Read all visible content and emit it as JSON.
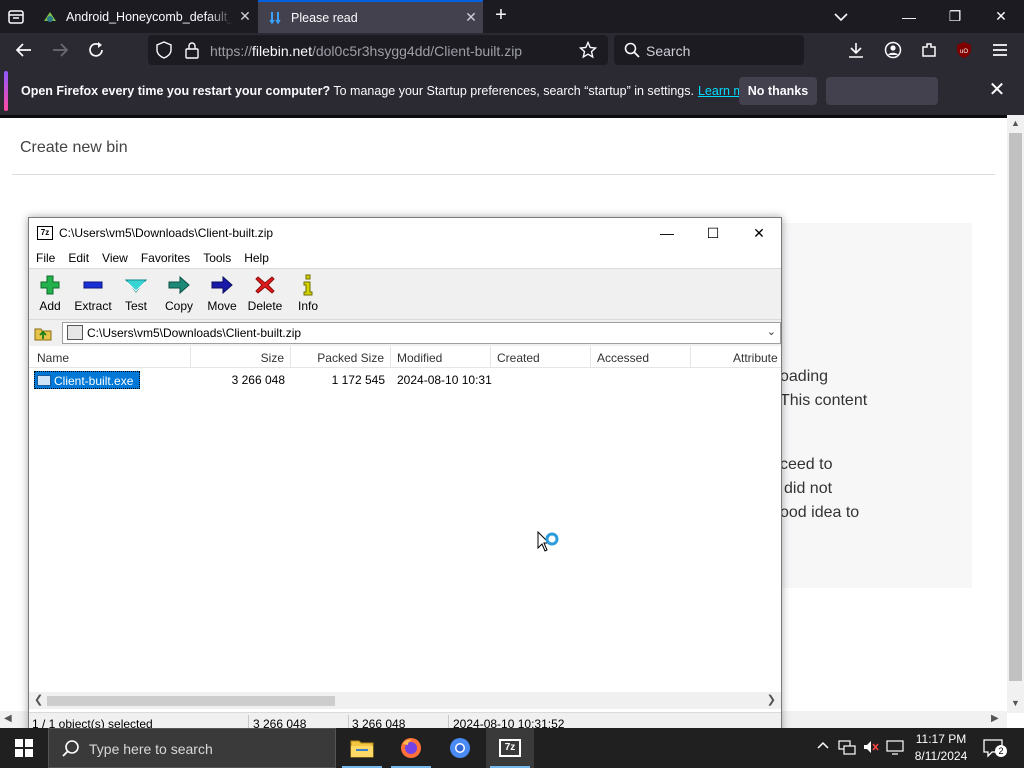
{
  "browser": {
    "tabs": [
      {
        "label": "Android_Honeycomb_default_w",
        "favicon": "android-honeycomb-icon"
      },
      {
        "label": "Please read",
        "favicon": "filebin-icon"
      }
    ],
    "address": {
      "prefix": "https://",
      "host": "filebin.net",
      "path": "/dol0c5r3hsygg4dd/Client-built.zip"
    },
    "search_placeholder": "Search",
    "notification": {
      "bold": "Open Firefox every time you restart your computer?",
      "text": "To manage your Startup preferences, search “startup” in settings.",
      "link": "Learn more",
      "no_thanks": "No thanks"
    }
  },
  "page": {
    "create_bin": "Create new bin",
    "fragments": [
      "oading",
      "This content",
      "ceed to",
      "did not",
      "ood idea to"
    ]
  },
  "zip": {
    "title": "C:\\Users\\vm5\\Downloads\\Client-built.zip",
    "menu": [
      "File",
      "Edit",
      "View",
      "Favorites",
      "Tools",
      "Help"
    ],
    "toolbar": [
      "Add",
      "Extract",
      "Test",
      "Copy",
      "Move",
      "Delete",
      "Info"
    ],
    "path": "C:\\Users\\vm5\\Downloads\\Client-built.zip",
    "columns": [
      "Name",
      "Size",
      "Packed Size",
      "Modified",
      "Created",
      "Accessed",
      "Attribute"
    ],
    "files": [
      {
        "name": "Client-built.exe",
        "size": "3 266 048",
        "packed": "1 172 545",
        "modified": "2024-08-10 10:31"
      }
    ],
    "status": {
      "selected": "1 / 1 object(s) selected",
      "size": "3 266 048",
      "packed": "3 266 048",
      "modified": "2024-08-10 10:31:52"
    }
  },
  "taskbar": {
    "search_placeholder": "Type here to search",
    "time": "11:17 PM",
    "date": "8/11/2024",
    "notification_count": "2"
  },
  "colors": {
    "accent": "#0078d7",
    "firefox_dark": "#1c1b22",
    "link": "#00ddff"
  }
}
